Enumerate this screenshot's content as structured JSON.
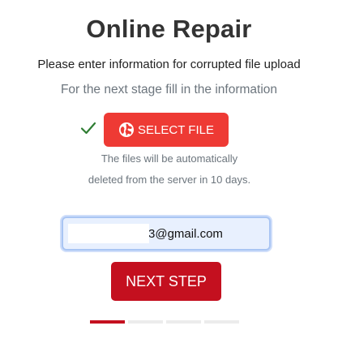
{
  "page": {
    "title": "Online Repair",
    "subtitle": "Please enter information for corrupted file upload",
    "hint": "For the next stage fill in the information"
  },
  "upload": {
    "status_icon": "checkmark-icon",
    "button_icon": "globe-icon",
    "button_label": "SELECT FILE",
    "note": "The files will be automatically deleted from the server in 10 days."
  },
  "email": {
    "value": "3@gmail.com"
  },
  "next_button": {
    "label": "NEXT STEP"
  },
  "progress": {
    "total_steps": 4,
    "current_step": 1
  },
  "colors": {
    "select_button": "#ee3a34",
    "next_button": "#c4101f",
    "check": "#2e7d32",
    "input_background": "#e8f0fe"
  }
}
